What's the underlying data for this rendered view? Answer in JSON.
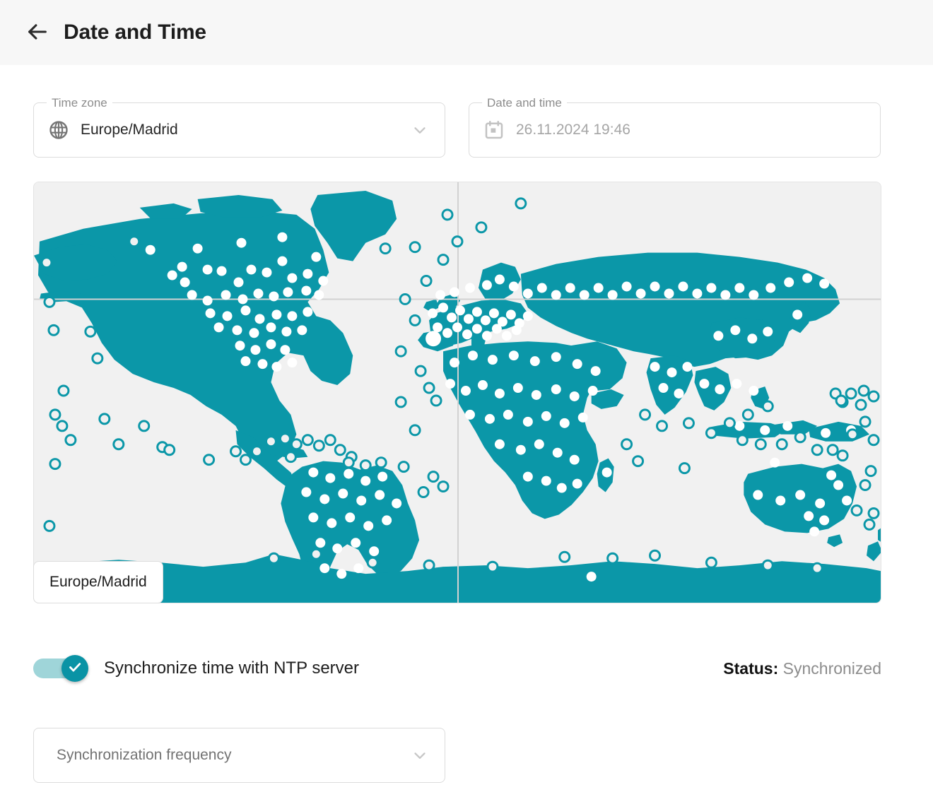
{
  "header": {
    "title": "Date and Time",
    "back_icon": "arrow-left-icon"
  },
  "timezone_field": {
    "legend": "Time zone",
    "value": "Europe/Madrid",
    "icon": "globe-icon",
    "chevron": "chevron-down-icon"
  },
  "datetime_field": {
    "legend": "Date and time",
    "value": "26.11.2024 19:46",
    "icon": "calendar-icon",
    "disabled": true
  },
  "map": {
    "selected_label": "Europe/Madrid",
    "land_color": "#0b97a8",
    "ocean_color": "#f1f1f1",
    "grid_color": "#d2d2d2",
    "marker_fill": "#ffffff",
    "marker_stroke": "#0b97a8"
  },
  "ntp_toggle": {
    "label": "Synchronize time with NTP server",
    "checked": true,
    "on_color": "#0a93a5",
    "track_color": "#9fd5d9",
    "check_icon": "check-icon"
  },
  "status": {
    "key": "Status:",
    "value": "Synchronized"
  },
  "frequency_field": {
    "placeholder": "Synchronization frequency",
    "value": "Synchronization frequency",
    "chevron": "chevron-down-icon"
  }
}
